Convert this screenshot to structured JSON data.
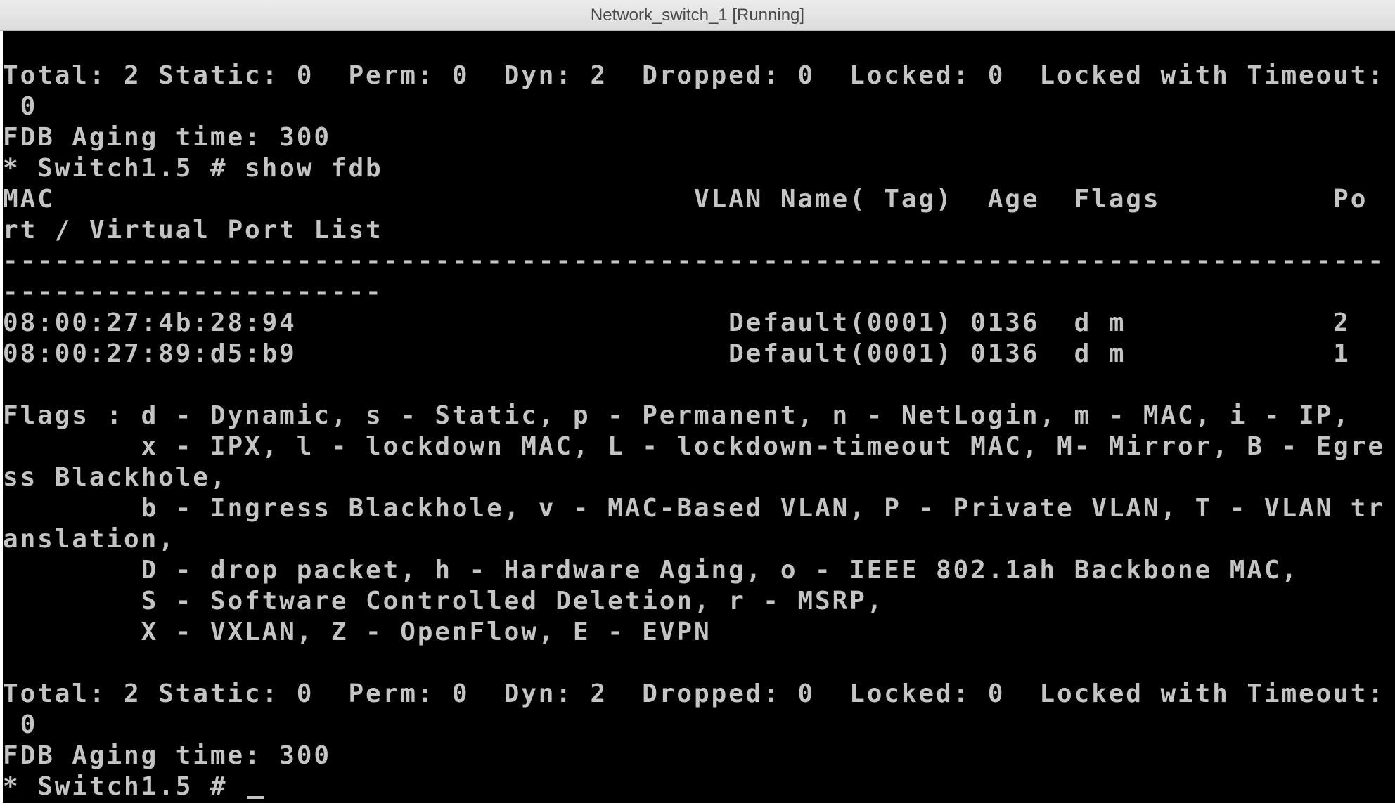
{
  "window": {
    "title": "Network_switch_1 [Running]"
  },
  "console": {
    "lines": [
      "Total: 2 Static: 0  Perm: 0  Dyn: 2  Dropped: 0  Locked: 0  Locked with Timeout:",
      " 0",
      "FDB Aging time: 300",
      "* Switch1.5 # show fdb",
      "MAC                                     VLAN Name( Tag)  Age  Flags          Po",
      "rt / Virtual Port List",
      "--------------------------------------------------------------------------------",
      "----------------------",
      "08:00:27:4b:28:94                         Default(0001) 0136  d m            2",
      "08:00:27:89:d5:b9                         Default(0001) 0136  d m            1",
      "",
      "Flags : d - Dynamic, s - Static, p - Permanent, n - NetLogin, m - MAC, i - IP,",
      "        x - IPX, l - lockdown MAC, L - lockdown-timeout MAC, M- Mirror, B - Egre",
      "ss Blackhole,",
      "        b - Ingress Blackhole, v - MAC-Based VLAN, P - Private VLAN, T - VLAN tr",
      "anslation,",
      "        D - drop packet, h - Hardware Aging, o - IEEE 802.1ah Backbone MAC,",
      "        S - Software Controlled Deletion, r - MSRP,",
      "        X - VXLAN, Z - OpenFlow, E - EVPN",
      "",
      "Total: 2 Static: 0  Perm: 0  Dyn: 2  Dropped: 0  Locked: 0  Locked with Timeout:",
      " 0",
      "FDB Aging time: 300"
    ],
    "prompt": "* Switch1.5 # "
  }
}
